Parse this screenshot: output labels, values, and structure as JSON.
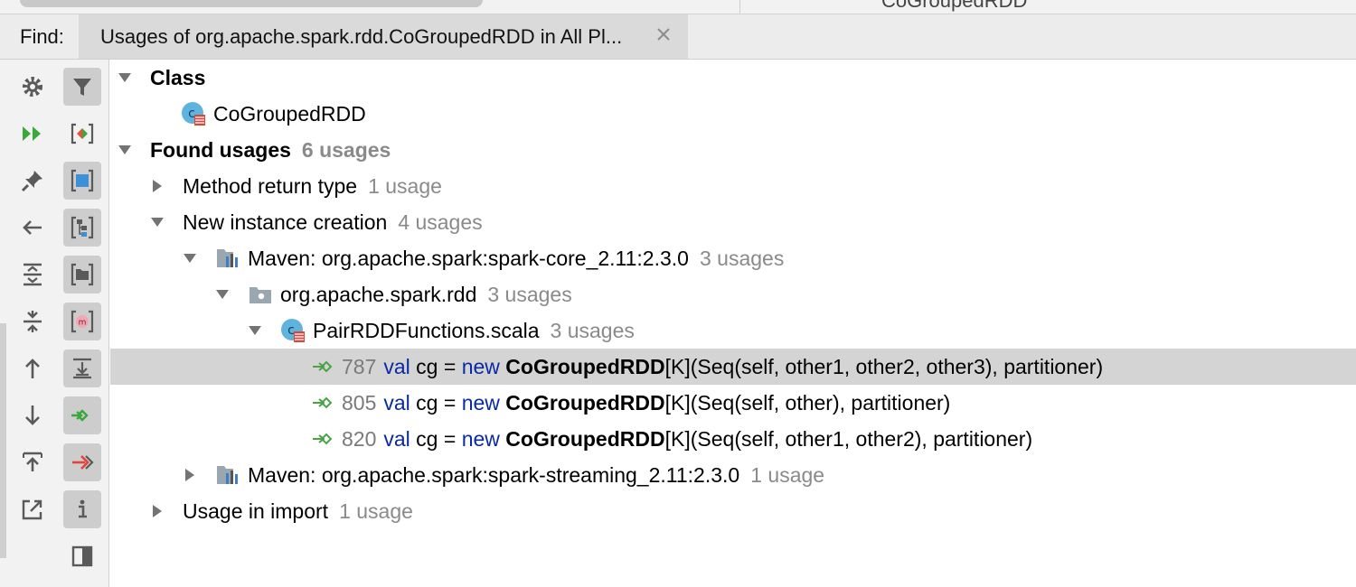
{
  "top_strip": {
    "peek_text": "CoGroupedRDD"
  },
  "find_bar": {
    "label": "Find:",
    "tab_title": "Usages of org.apache.spark.rdd.CoGroupedRDD in All Pl..."
  },
  "toolbar": {
    "left_column": [
      "gear-icon",
      "rerun-icon",
      "pin-icon",
      "back-arrow-icon",
      "expand-all-icon",
      "collapse-all-icon",
      "previous-occurrence-icon",
      "next-occurrence-icon",
      "export-icon"
    ],
    "right_column": [
      "filter-icon",
      "merge-duplicates-icon",
      "group-by-module-icon",
      "group-by-package-icon",
      "group-by-directory-icon",
      "group-by-method-icon",
      "autoscroll-icon",
      "show-read-access-icon",
      "show-write-access-icon",
      "info-icon",
      "preview-panel-icon"
    ]
  },
  "tree": {
    "class_header": "Class",
    "class_item": "CoGroupedRDD",
    "found_header": "Found usages",
    "found_count": "6 usages",
    "method_return": {
      "label": "Method return type",
      "count": "1 usage"
    },
    "new_instance": {
      "label": "New instance creation",
      "count": "4 usages"
    },
    "maven_core": {
      "label": "Maven: org.apache.spark:spark-core_2.11:2.3.0",
      "count": "3 usages"
    },
    "package": {
      "label": "org.apache.spark.rdd",
      "count": "3 usages"
    },
    "file": {
      "label": "PairRDDFunctions.scala",
      "count": "3 usages"
    },
    "usages": [
      {
        "line": "787",
        "kw1": "val",
        "var": "cg =",
        "kw2": "new",
        "cls": "CoGroupedRDD",
        "rest": "[K](Seq(self, other1, other2, other3), partitioner)"
      },
      {
        "line": "805",
        "kw1": "val",
        "var": "cg =",
        "kw2": "new",
        "cls": "CoGroupedRDD",
        "rest": "[K](Seq(self, other), partitioner)"
      },
      {
        "line": "820",
        "kw1": "val",
        "var": "cg =",
        "kw2": "new",
        "cls": "CoGroupedRDD",
        "rest": "[K](Seq(self, other1, other2), partitioner)"
      }
    ],
    "maven_streaming": {
      "label": "Maven: org.apache.spark:spark-streaming_2.11:2.3.0",
      "count": "1 usage"
    },
    "usage_import": {
      "label": "Usage in import",
      "count": "1 usage"
    }
  },
  "colors": {
    "keyword": "#0a2aa3",
    "count": "#8a8a8a",
    "selection": "#d4d4d4",
    "usage_arrow": "#4aa24a"
  }
}
